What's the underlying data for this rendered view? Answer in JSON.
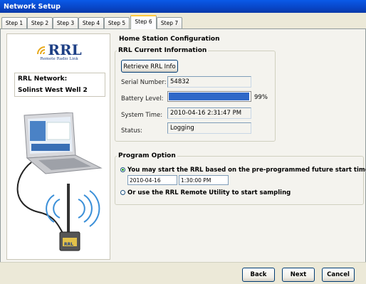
{
  "window": {
    "title": "Network Setup"
  },
  "tabs": [
    {
      "label": "Step 1"
    },
    {
      "label": "Step 2"
    },
    {
      "label": "Step 3"
    },
    {
      "label": "Step 4"
    },
    {
      "label": "Step 5"
    },
    {
      "label": "Step 6",
      "active": true
    },
    {
      "label": "Step 7"
    }
  ],
  "sidebar": {
    "logo_text": "RRL",
    "logo_subtext": "Remote Radio Link",
    "network_label": "RRL Network:",
    "network_value": "Solinst West Well 2",
    "device_label": "RRL"
  },
  "main": {
    "heading": "Home Station Configuration",
    "rrl_group": {
      "legend": "RRL Current Information",
      "retrieve_button": "Retrieve RRL Info",
      "serial_label": "Serial Number:",
      "serial_value": "54832",
      "battery_label": "Battery Level:",
      "battery_percent": 99,
      "battery_text": "99%",
      "time_label": "System Time:",
      "time_value": "2010-04-16 2:31:47 PM",
      "status_label": "Status:",
      "status_value": "Logging"
    },
    "program_group": {
      "legend": "Program Option",
      "option1_label": "You may start the RRL based on the pre-programmed future start time",
      "option1_checked": true,
      "start_date": "2010-04-16",
      "start_time": "1:30:00 PM",
      "option2_label": "Or use the RRL Remote Utility to start sampling",
      "option2_checked": false
    }
  },
  "footer": {
    "back_label": "Back",
    "next_label": "Next",
    "cancel_label": "Cancel"
  },
  "colors": {
    "titlebar": "#0845c7",
    "progress": "#2f68c8",
    "logo": "#1d3f85"
  }
}
